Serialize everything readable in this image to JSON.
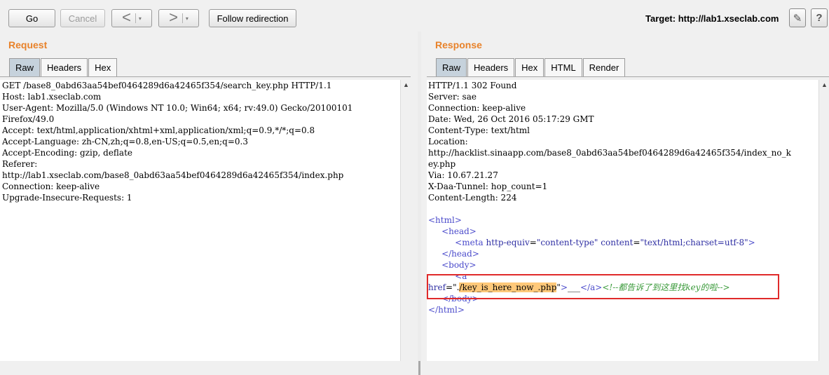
{
  "toolbar": {
    "go_label": "Go",
    "cancel_label": "Cancel",
    "back_symbol": "<",
    "forward_symbol": ">",
    "dropdown_symbol": "▾",
    "follow_redirection_label": "Follow redirection",
    "target_label": "Target: http://lab1.xseclab.com"
  },
  "request": {
    "title": "Request",
    "tabs": [
      "Raw",
      "Headers",
      "Hex"
    ],
    "active_tab": "Raw",
    "lines": [
      "GET /base8_0abd63aa54bef0464289d6a42465f354/search_key.php HTTP/1.1",
      "Host: lab1.xseclab.com",
      "User-Agent: Mozilla/5.0 (Windows NT 10.0; Win64; x64; rv:49.0) Gecko/20100101",
      "Firefox/49.0",
      "Accept: text/html,application/xhtml+xml,application/xml;q=0.9,*/*;q=0.8",
      "Accept-Language: zh-CN,zh;q=0.8,en-US;q=0.5,en;q=0.3",
      "Accept-Encoding: gzip, deflate",
      "Referer:",
      "http://lab1.xseclab.com/base8_0abd63aa54bef0464289d6a42465f354/index.php",
      "Connection: keep-alive",
      "Upgrade-Insecure-Requests: 1"
    ]
  },
  "response": {
    "title": "Response",
    "tabs": [
      "Raw",
      "Headers",
      "Hex",
      "HTML",
      "Render"
    ],
    "active_tab": "Raw",
    "header_lines": [
      "HTTP/1.1 302 Found",
      "Server: sae",
      "Connection: keep-alive",
      "Date: Wed, 26 Oct 2016 05:17:29 GMT",
      "Content-Type: text/html",
      "Location:",
      "http://hacklist.sinaapp.com/base8_0abd63aa54bef0464289d6a42465f354/index_no_k",
      "ey.php",
      "Via: 10.67.21.27",
      "X-Daa-Tunnel: hop_count=1",
      "Content-Length: 224"
    ],
    "body": {
      "html_open": "<html>",
      "head_open": "<head>",
      "meta_tag_open": "<meta",
      "meta_attr1": "http-equiv",
      "meta_eq": "=",
      "meta_val1": "\"content-type\"",
      "meta_attr2": "content",
      "meta_val2": "\"text/html;charset=utf-8\"",
      "meta_tag_close": ">",
      "head_close": "</head>",
      "body_open": "<body>",
      "a_open": "<a",
      "href_attr": "href",
      "href_quote_open": "=\".",
      "href_value": "/key_is_here_now_.php",
      "href_quote_close": "\"",
      "a_gt": ">",
      "link_text": "___",
      "a_close": "</a>",
      "comment": "<!--都告诉了到这里找key的啦-->",
      "body_close": "</body>",
      "html_close": "</html>"
    }
  },
  "icons": {
    "edit": "✎",
    "help": "?",
    "scroll_up": "▲"
  },
  "colors": {
    "section_title": "#e8822a",
    "active_tab": "#c6d2dc",
    "highlight": "#ffc97a",
    "annotation_box": "#e02a2a",
    "tag": "#4a4acb",
    "comment": "#3a9a3a"
  }
}
